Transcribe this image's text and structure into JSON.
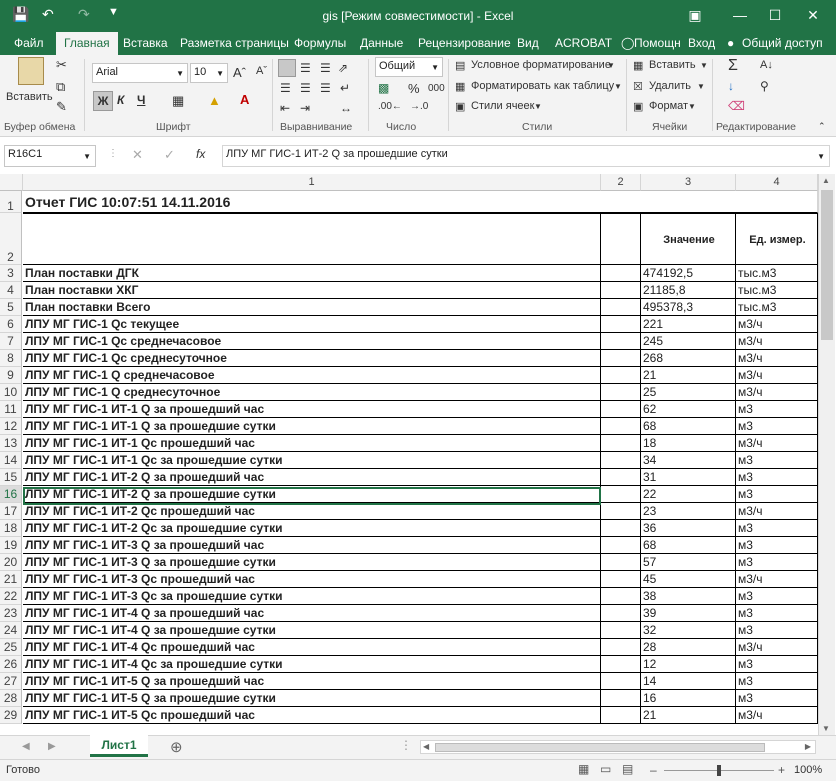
{
  "window": {
    "title": "gis  [Режим совместимости] - Excel",
    "qat_icons": [
      "save-icon",
      "undo-icon",
      "redo-icon",
      "customize-icon"
    ],
    "controls": [
      "ribbon-display-icon",
      "minimize-icon",
      "maximize-icon",
      "close-icon"
    ]
  },
  "tabs": [
    "Файл",
    "Главная",
    "Вставка",
    "Разметка страницы",
    "Формулы",
    "Данные",
    "Рецензирование",
    "Вид",
    "ACROBAT",
    "Помощн",
    "Вход",
    "Общий доступ"
  ],
  "active_tab": "Главная",
  "ribbon": {
    "clipboard": {
      "paste": "Вставить",
      "label": "Буфер обмена"
    },
    "font": {
      "name": "Arial",
      "size": "10",
      "bold": "Ж",
      "italic": "К",
      "underline": "Ч",
      "label": "Шрифт"
    },
    "alignment": {
      "label": "Выравнивание"
    },
    "number": {
      "format": "Общий",
      "percent": "%",
      "thousands": "000",
      "label": "Число"
    },
    "styles": {
      "conditional": "Условное форматирование",
      "as_table": "Форматировать как таблицу",
      "cell_styles": "Стили ячеек",
      "label": "Стили"
    },
    "cells": {
      "insert": "Вставить",
      "delete": "Удалить",
      "format": "Формат",
      "label": "Ячейки"
    },
    "editing": {
      "label": "Редактирование"
    }
  },
  "formula_bar": {
    "name_box": "R16C1",
    "fx": "fx",
    "content": "ЛПУ МГ ГИС-1 ИТ-2 Q за прошедшие сутки"
  },
  "columns": [
    "1",
    "2",
    "3",
    "4"
  ],
  "report_title": "Отчет ГИС 10:07:51 14.11.2016",
  "header": {
    "value": "Значение",
    "unit": "Ед. измер."
  },
  "rows": [
    {
      "n": "3",
      "name": "План поставки ДГК",
      "value": "474192,5",
      "unit": "тыс.м3"
    },
    {
      "n": "4",
      "name": "План поставки  ХКГ",
      "value": "21185,8",
      "unit": "тыс.м3"
    },
    {
      "n": "5",
      "name": "План поставки  Всего",
      "value": "495378,3",
      "unit": "тыс.м3"
    },
    {
      "n": "6",
      "name": "ЛПУ МГ ГИС-1 Qc текущее",
      "value": "221",
      "unit": "м3/ч"
    },
    {
      "n": "7",
      "name": "ЛПУ МГ ГИС-1 Qc среднечасовое",
      "value": "245",
      "unit": "м3/ч"
    },
    {
      "n": "8",
      "name": "ЛПУ МГ ГИС-1 Qc среднесуточное",
      "value": "268",
      "unit": "м3/ч"
    },
    {
      "n": "9",
      "name": "ЛПУ МГ ГИС-1 Q среднечасовое",
      "value": "21",
      "unit": "м3/ч"
    },
    {
      "n": "10",
      "name": "ЛПУ МГ ГИС-1 Q среднесуточное",
      "value": "25",
      "unit": "м3/ч"
    },
    {
      "n": "11",
      "name": "ЛПУ МГ ГИС-1 ИТ-1 Q за прошедший час",
      "value": "62",
      "unit": "м3"
    },
    {
      "n": "12",
      "name": "ЛПУ МГ ГИС-1 ИТ-1 Q за прошедшие сутки",
      "value": "68",
      "unit": "м3"
    },
    {
      "n": "13",
      "name": "ЛПУ МГ ГИС-1 ИТ-1 Qc прошедший час",
      "value": "18",
      "unit": "м3/ч"
    },
    {
      "n": "14",
      "name": "ЛПУ МГ ГИС-1 ИТ-1 Qc за прошедшие сутки",
      "value": "34",
      "unit": "м3"
    },
    {
      "n": "15",
      "name": "ЛПУ МГ ГИС-1 ИТ-2 Q за прошедший час",
      "value": "31",
      "unit": "м3"
    },
    {
      "n": "16",
      "name": "ЛПУ МГ ГИС-1 ИТ-2 Q за прошедшие сутки",
      "value": "22",
      "unit": "м3"
    },
    {
      "n": "17",
      "name": "ЛПУ МГ ГИС-1 ИТ-2 Qc прошедший час",
      "value": "23",
      "unit": "м3/ч"
    },
    {
      "n": "18",
      "name": "ЛПУ МГ ГИС-1 ИТ-2 Qc за прошедшие сутки",
      "value": "36",
      "unit": "м3"
    },
    {
      "n": "19",
      "name": "ЛПУ МГ ГИС-1 ИТ-3 Q за прошедший час",
      "value": "68",
      "unit": "м3"
    },
    {
      "n": "20",
      "name": "ЛПУ МГ ГИС-1 ИТ-3 Q за прошедшие сутки",
      "value": "57",
      "unit": "м3"
    },
    {
      "n": "21",
      "name": "ЛПУ МГ ГИС-1 ИТ-3 Qc прошедший час",
      "value": "45",
      "unit": "м3/ч"
    },
    {
      "n": "22",
      "name": "ЛПУ МГ ГИС-1 ИТ-3 Qc за прошедшие сутки",
      "value": "38",
      "unit": "м3"
    },
    {
      "n": "23",
      "name": "ЛПУ МГ ГИС-1 ИТ-4 Q за прошедший час",
      "value": "39",
      "unit": "м3"
    },
    {
      "n": "24",
      "name": "ЛПУ МГ ГИС-1 ИТ-4 Q за прошедшие сутки",
      "value": "32",
      "unit": "м3"
    },
    {
      "n": "25",
      "name": "ЛПУ МГ ГИС-1 ИТ-4 Qc прошедший час",
      "value": "28",
      "unit": "м3/ч"
    },
    {
      "n": "26",
      "name": "ЛПУ МГ ГИС-1 ИТ-4 Qc за прошедшие сутки",
      "value": "12",
      "unit": "м3"
    },
    {
      "n": "27",
      "name": "ЛПУ МГ ГИС-1 ИТ-5 Q за прошедший час",
      "value": "14",
      "unit": "м3"
    },
    {
      "n": "28",
      "name": "ЛПУ МГ ГИС-1 ИТ-5 Q за прошедшие сутки",
      "value": "16",
      "unit": "м3"
    },
    {
      "n": "29",
      "name": "ЛПУ МГ ГИС-1 ИТ-5 Qc прошедший час",
      "value": "21",
      "unit": "м3/ч"
    }
  ],
  "sheet_tab": "Лист1",
  "status": {
    "ready": "Готово",
    "zoom": "100%"
  },
  "colors": {
    "accent": "#217346"
  }
}
